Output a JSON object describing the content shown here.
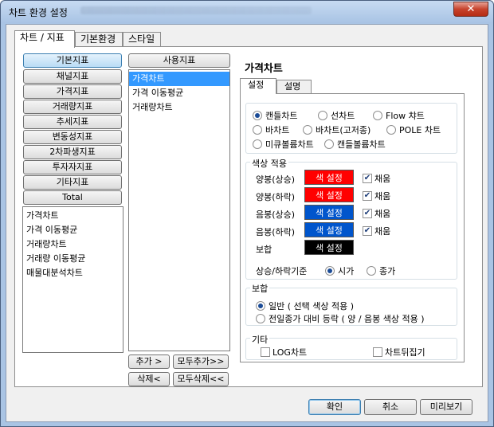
{
  "window": {
    "title": "차트 환경 설정",
    "close_label": "✕"
  },
  "tabs_top": [
    {
      "label": "차트 / 지표"
    },
    {
      "label": "기본환경"
    },
    {
      "label": "스타일"
    }
  ],
  "categories": [
    {
      "label": "기본지표"
    },
    {
      "label": "채널지표"
    },
    {
      "label": "가격지표"
    },
    {
      "label": "거래량지표"
    },
    {
      "label": "추세지표"
    },
    {
      "label": "변동성지표"
    },
    {
      "label": "2차파생지표"
    },
    {
      "label": "투자자지표"
    },
    {
      "label": "기타지표"
    },
    {
      "label": "Total"
    }
  ],
  "indicator_list": [
    "가격차트",
    "가격 이동평균",
    "거래량차트",
    "거래량 이동평균",
    "매물대분석차트"
  ],
  "used": {
    "header": "사용지표",
    "items": [
      "가격차트",
      "가격 이동평균",
      "거래량차트"
    ],
    "add_label": "추가 >",
    "add_all_label": "모두추가>>",
    "remove_label": "삭제<",
    "remove_all_label": "모두삭제<<"
  },
  "detail": {
    "title": "가격차트",
    "tab_settings": "설정",
    "tab_description": "설명",
    "chart_types": [
      {
        "label": "캔들차트",
        "selected": true
      },
      {
        "label": "선차트",
        "selected": false
      },
      {
        "label": "Flow 챠트",
        "selected": false
      },
      {
        "label": "바차트",
        "selected": false
      },
      {
        "label": "바차트(고저종)",
        "selected": false
      },
      {
        "label": "POLE 차트",
        "selected": false
      },
      {
        "label": "미큐볼륨차트",
        "selected": false
      },
      {
        "label": "캔들볼륨차트",
        "selected": false
      }
    ],
    "color_section": "색상 적용",
    "color_rows": [
      {
        "label": "양봉(상승)",
        "button": "색 설정",
        "color": "#ff0000",
        "fill_label": "채움",
        "fill": true
      },
      {
        "label": "양봉(하락)",
        "button": "색 설정",
        "color": "#ff0000",
        "fill_label": "채움",
        "fill": true
      },
      {
        "label": "음봉(상승)",
        "button": "색 설정",
        "color": "#0055cc",
        "fill_label": "채움",
        "fill": true
      },
      {
        "label": "음봉(하락)",
        "button": "색 설정",
        "color": "#0055cc",
        "fill_label": "채움",
        "fill": true
      },
      {
        "label": "보합",
        "button": "색 설정",
        "color": "#000000"
      }
    ],
    "basis_label": "상승/하락기준",
    "basis_options": [
      {
        "label": "시가",
        "selected": true
      },
      {
        "label": "종가",
        "selected": false
      }
    ],
    "flat_section": "보합",
    "flat_options": [
      {
        "label": "일반 ( 선택 색상 적용 )",
        "selected": true
      },
      {
        "label": "전일종가 대비 등락 ( 양 / 음봉 색상 적용 )",
        "selected": false
      }
    ],
    "etc_section": "기타",
    "etc_options": [
      {
        "label": "LOG차트",
        "checked": false
      },
      {
        "label": "차트뒤집기",
        "checked": false
      }
    ]
  },
  "footer": {
    "ok": "확인",
    "cancel": "취소",
    "preview": "미리보기"
  }
}
